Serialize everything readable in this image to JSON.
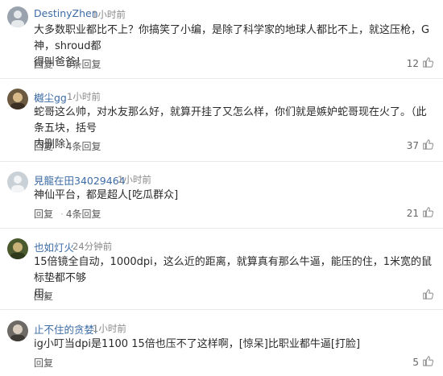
{
  "comments": [
    {
      "username": "DestinyZhen",
      "time": "1小时前",
      "text_lines": [
        "大多数职业都比不上？你搞笑了小编，是除了科学家的地球人都比不上，就这压枪，G神，shroud都",
        "得叫爸爸！"
      ],
      "reply_label": "回复",
      "replies_label": "8条回复",
      "likes": "12",
      "avatar_color": "#9aa3ad"
    },
    {
      "username": "樾尘gg",
      "time": "1小时前",
      "text_lines": [
        "蛇哥这么帅，对水友那么好，就算开挂了又怎么样，你们就是嫉妒蛇哥现在火了。（此条五块，括号",
        "内删除）"
      ],
      "reply_label": "回复",
      "replies_label": "4条回复",
      "likes": "37",
      "avatar_color": "#6b5a3f"
    },
    {
      "username": "見龍在田34029464",
      "time": "1小时前",
      "text_lines": [
        "神仙平台，都是超人[吃瓜群众]"
      ],
      "reply_label": "回复",
      "replies_label": "4条回复",
      "likes": "21",
      "avatar_color": "#c9d0d6"
    },
    {
      "username": "也如灯火",
      "time": "24分钟前",
      "text_lines": [
        "15倍镜全自动，1000dpi，这么近的距离，就算真有那么牛逼，能压的住，1米宽的鼠标垫都不够",
        "用。"
      ],
      "reply_label": "回复",
      "replies_label": "",
      "likes": "",
      "avatar_color": "#4a5a2e"
    },
    {
      "username": "止不住的贪婪l",
      "time": "1小时前",
      "text_lines": [
        "ig小叮当dpi是1100 15倍也压不了这样啊，[惊呆]比职业都牛逼[打脸]"
      ],
      "reply_label": "回复",
      "replies_label": "",
      "likes": "5",
      "avatar_color": "#6d6a66"
    }
  ]
}
